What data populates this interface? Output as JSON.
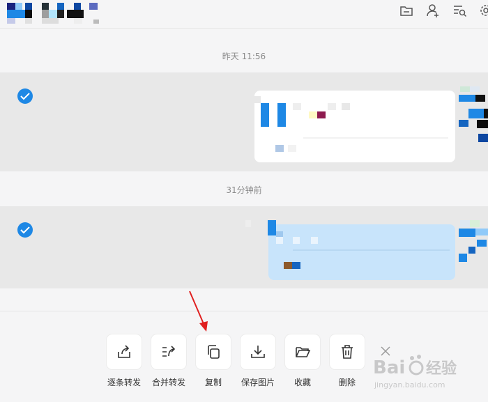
{
  "colors": {
    "accent": "#1e88e5",
    "arrow": "#e02020"
  },
  "timestamps": {
    "first": "昨天 11:56",
    "second": "31分钟前"
  },
  "header_icons": [
    "folder-icon",
    "add-user-icon",
    "search-list-icon",
    "settings-icon"
  ],
  "toolbar": {
    "items": [
      {
        "label": "逐条转发",
        "icon": "share-icon"
      },
      {
        "label": "合并转发",
        "icon": "merge-forward-icon"
      },
      {
        "label": "复制",
        "icon": "copy-icon"
      },
      {
        "label": "保存图片",
        "icon": "download-icon"
      },
      {
        "label": "收藏",
        "icon": "folder-open-icon"
      },
      {
        "label": "删除",
        "icon": "trash-icon"
      }
    ]
  },
  "watermark": {
    "brand": "Baidu经验",
    "url": "jingyan.baidu.com"
  }
}
